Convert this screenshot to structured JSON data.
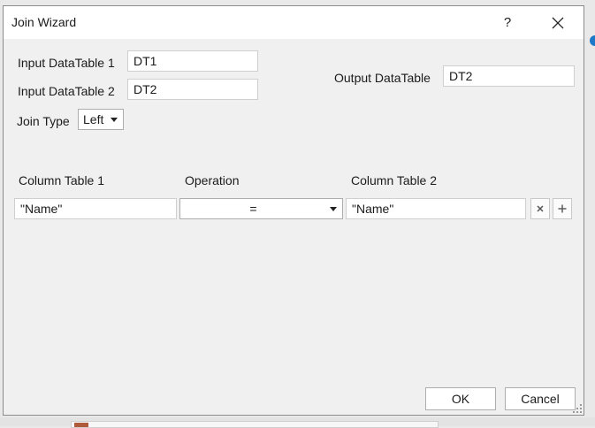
{
  "window": {
    "title": "Join Wizard"
  },
  "title_controls": {
    "help_label": "?"
  },
  "inputs": {
    "dt1_label": "Input DataTable 1",
    "dt1_value": "DT1",
    "dt2_label": "Input DataTable 2",
    "dt2_value": "DT2",
    "output_label": "Output DataTable",
    "output_value": "DT2"
  },
  "join_type": {
    "label": "Join Type",
    "selected": "Left"
  },
  "rules": {
    "headers": {
      "col1": "Column Table 1",
      "operation": "Operation",
      "col2": "Column Table 2"
    },
    "rows": [
      {
        "col1": "\"Name\"",
        "operation": "=",
        "col2": "\"Name\""
      }
    ]
  },
  "buttons": {
    "ok": "OK",
    "cancel": "Cancel"
  },
  "colors": {
    "dialog_bg": "#f0f0f0",
    "titlebar_bg": "#ffffff",
    "field_border": "#cfcfcf"
  }
}
